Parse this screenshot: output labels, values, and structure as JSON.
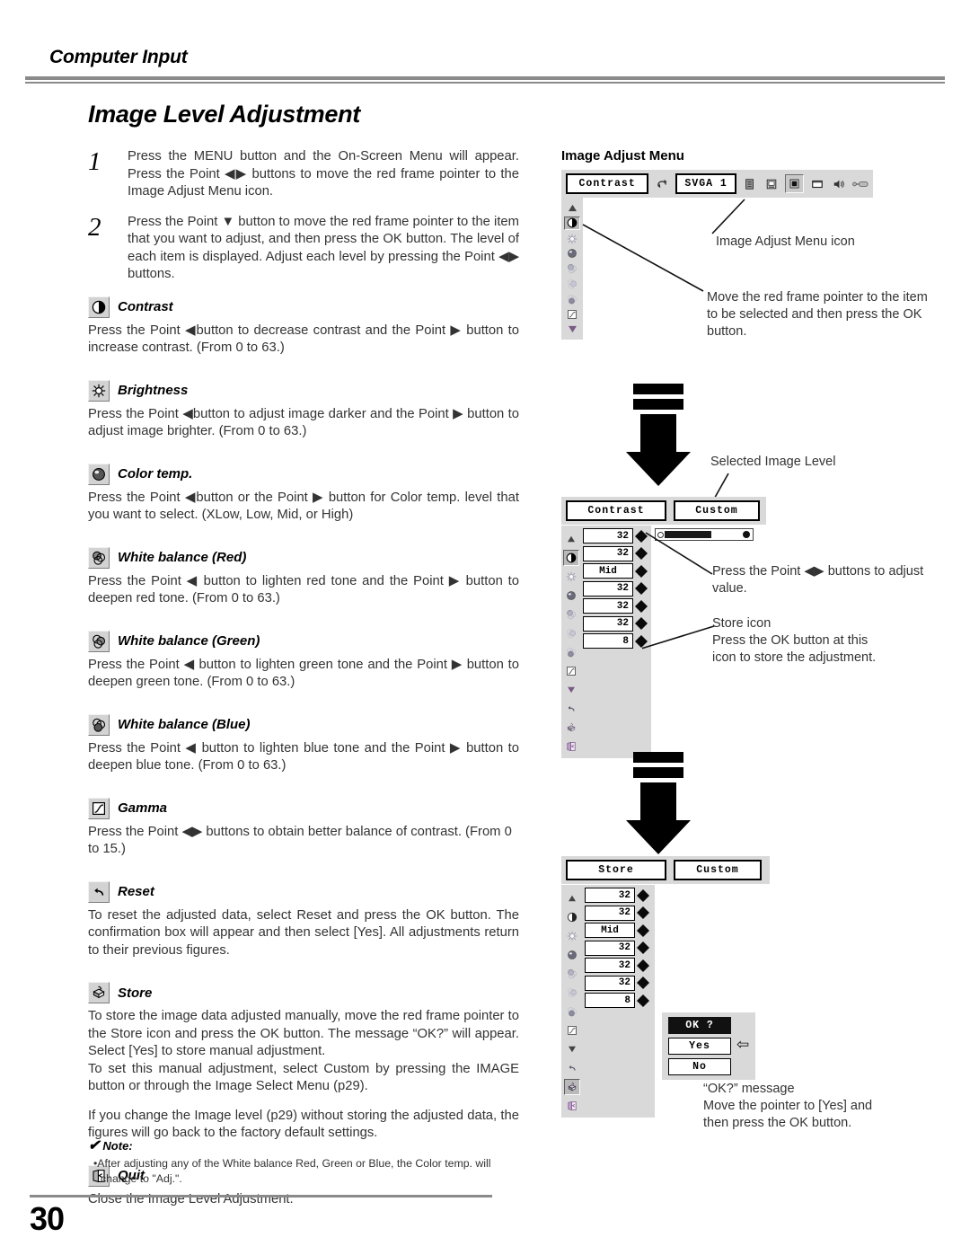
{
  "header": {
    "running_head": "Computer Input",
    "page_number": "30"
  },
  "title": "Image Level Adjustment",
  "steps": [
    {
      "num": "1",
      "text": "Press the MENU button and the On-Screen Menu will appear.  Press the Point ◀▶ buttons to move the red frame pointer to the Image Adjust Menu icon."
    },
    {
      "num": "2",
      "text": "Press the Point ▼ button to move the red frame pointer to the item that you want to adjust, and then press the OK button.  The level of each item is displayed.  Adjust each level by pressing the Point ◀▶ buttons."
    }
  ],
  "sections": [
    {
      "icon": "contrast-icon",
      "title": "Contrast",
      "body": "Press the Point ◀button to decrease contrast and the Point ▶ button to increase contrast.  (From 0 to 63.)"
    },
    {
      "icon": "brightness-icon",
      "title": "Brightness",
      "body": "Press the Point ◀button to adjust image darker and the Point ▶ button to adjust image brighter.  (From 0 to 63.)"
    },
    {
      "icon": "color-temp-icon",
      "title": "Color temp.",
      "body": "Press the Point ◀button or the Point ▶ button for Color temp. level that you want to select. (XLow, Low, Mid, or High)"
    },
    {
      "icon": "white-balance-red-icon",
      "title": "White balance (Red)",
      "body": "Press the Point ◀ button to lighten red tone and the Point ▶ button to deepen red tone.  (From 0 to 63.)"
    },
    {
      "icon": "white-balance-green-icon",
      "title": "White balance (Green)",
      "body": "Press the Point ◀ button to lighten green tone and the Point ▶ button to deepen green tone.  (From 0 to 63.)"
    },
    {
      "icon": "white-balance-blue-icon",
      "title": "White balance (Blue)",
      "body": "Press the Point ◀ button to lighten blue tone and the Point ▶ button to deepen blue tone.  (From 0 to 63.)"
    },
    {
      "icon": "gamma-icon",
      "title": "Gamma",
      "body": "Press the Point ◀▶ buttons to obtain better balance of contrast. (From 0 to 15.)"
    },
    {
      "icon": "reset-icon",
      "title": "Reset",
      "body": "To reset the adjusted data, select Reset and press the OK button.  The confirmation box will appear and then select [Yes].  All adjustments return to their previous figures."
    },
    {
      "icon": "store-icon",
      "title": "Store",
      "body": "To store the image data adjusted manually, move the red frame pointer to the Store icon and press the OK button. The message “OK?” will appear.  Select [Yes] to store manual adjustment.",
      "body2": "To set this manual adjustment, select Custom by pressing the IMAGE button or through the Image Select Menu (p29).",
      "body3": "If you change the Image level (p29) without storing the adjusted data, the figures will go back to the factory default settings."
    },
    {
      "icon": "quit-icon",
      "title": "Quit",
      "body": "Close the Image Level Adjustment."
    }
  ],
  "note": {
    "check": "✔",
    "label": "Note:",
    "text": "•After adjusting any of the White balance Red, Green or Blue, the Color temp. will change to \"Adj.\"."
  },
  "right": {
    "menu_title": "Image Adjust Menu",
    "osd1": {
      "item_label": "Contrast",
      "source_label": "SVGA 1",
      "toolbar_icons": [
        "refresh-icon",
        "input-icon",
        "pc-adjust-icon",
        "image-adjust-icon",
        "screen-icon",
        "sound-icon",
        "setting-icon"
      ],
      "rail_icons": [
        "scroll-up-icon",
        "contrast-icon",
        "brightness-icon",
        "color-temp-icon",
        "white-balance-red-icon",
        "white-balance-green-icon",
        "white-balance-blue-icon",
        "gamma-icon",
        "scroll-down-icon"
      ]
    },
    "callout_menu_icon": "Image Adjust Menu icon",
    "callout_pointer": "Move the red frame pointer to the item to be selected and then press the OK button.",
    "osd2": {
      "item_label": "Contrast",
      "level_label": "Custom",
      "values": [
        "32",
        "32",
        "Mid",
        "32",
        "32",
        "32",
        "8"
      ],
      "rail_icons": [
        "scroll-up-icon",
        "contrast-icon",
        "brightness-icon",
        "color-temp-icon",
        "white-balance-red-icon",
        "white-balance-green-icon",
        "white-balance-blue-icon",
        "gamma-icon",
        "scroll-down-icon",
        "reset-icon",
        "store-icon",
        "quit-icon"
      ],
      "slider_percent": 50
    },
    "callout_selected_level": "Selected Image Level",
    "callout_adjust": "Press the Point ◀▶ buttons to adjust value.",
    "callout_store": "Store icon\nPress the OK button at this icon to store the adjustment.",
    "callout_store_line1": "Store icon",
    "callout_store_line2": "Press the OK button at this",
    "callout_store_line3": "icon to store the adjustment.",
    "osd3": {
      "item_label": "Store",
      "level_label": "Custom",
      "values": [
        "32",
        "32",
        "Mid",
        "32",
        "32",
        "32",
        "8"
      ],
      "rail_icons": [
        "scroll-up-icon",
        "contrast-icon",
        "brightness-icon",
        "color-temp-icon",
        "white-balance-red-icon",
        "white-balance-green-icon",
        "white-balance-blue-icon",
        "gamma-icon",
        "scroll-down-icon",
        "reset-icon",
        "store-icon",
        "quit-icon"
      ],
      "confirm": {
        "title": "OK ?",
        "yes": "Yes",
        "no": "No",
        "pointer": "⇦"
      }
    },
    "callout_ok_line1": "“OK?” message",
    "callout_ok_line2": "Move the pointer to [Yes] and",
    "callout_ok_line3": "then press the OK button."
  }
}
